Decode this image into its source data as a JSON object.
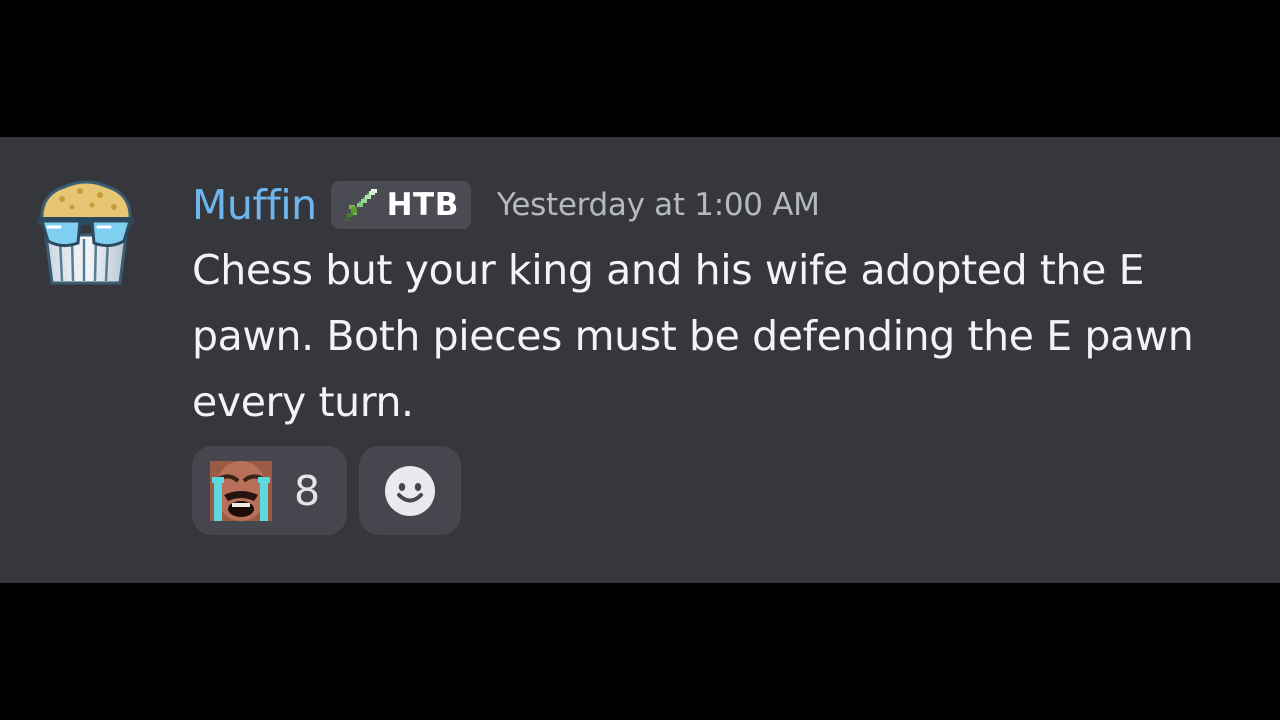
{
  "message": {
    "author": {
      "name": "Muffin",
      "name_color": "#6fb6ee",
      "avatar_icon": "sunglasses-muffin-avatar"
    },
    "role_tag": {
      "icon": "pixel-sword-icon",
      "label": "HTB"
    },
    "timestamp": "Yesterday at 1:00 AM",
    "text": "Chess but your king and his wife adopted the E pawn. Both pieces must be defending the E pawn every turn.",
    "reactions": [
      {
        "emoji": "crying-face-emoji",
        "count": "8"
      }
    ],
    "add_reaction_icon": "smile-icon"
  },
  "colors": {
    "background": "#000000",
    "message_background": "#36373d",
    "reaction_background": "#46474e",
    "text": "#f2f3f5",
    "timestamp": "#b5b8be"
  }
}
